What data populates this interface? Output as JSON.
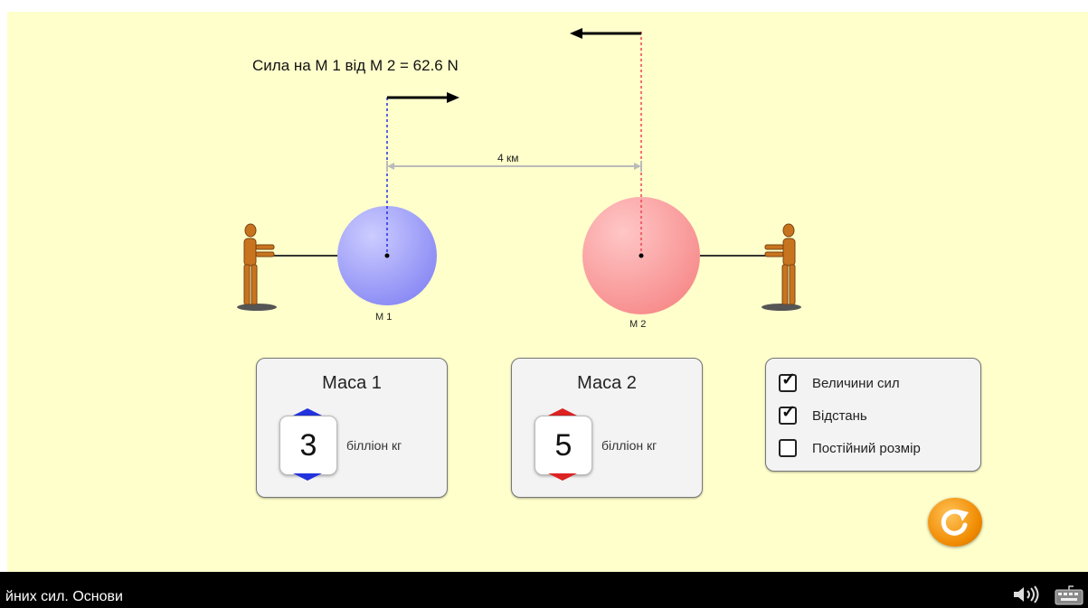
{
  "simulation": {
    "force_label": "Сила на М 1 від М 2 = 62.6 N",
    "distance_label": "4 км",
    "mass1_label": "М 1",
    "mass2_label": "М 2",
    "mass1_color": "#9999ff",
    "mass2_color": "#ff9999"
  },
  "mass1_panel": {
    "title": "Маса 1",
    "value": "3",
    "unit": "білліон кг",
    "arrow_color": "#2233dd"
  },
  "mass2_panel": {
    "title": "Маса 2",
    "value": "5",
    "unit": "білліон кг",
    "arrow_color": "#dd2222"
  },
  "options": [
    {
      "label": "Величини сил",
      "checked": true
    },
    {
      "label": "Відстань",
      "checked": true
    },
    {
      "label": "Постійний розмір",
      "checked": false
    }
  ],
  "bottom_bar": {
    "title": "йних сил. Основи"
  },
  "icons": {
    "reset": "reset-icon",
    "sound": "sound-icon",
    "keyboard": "keyboard-icon"
  }
}
